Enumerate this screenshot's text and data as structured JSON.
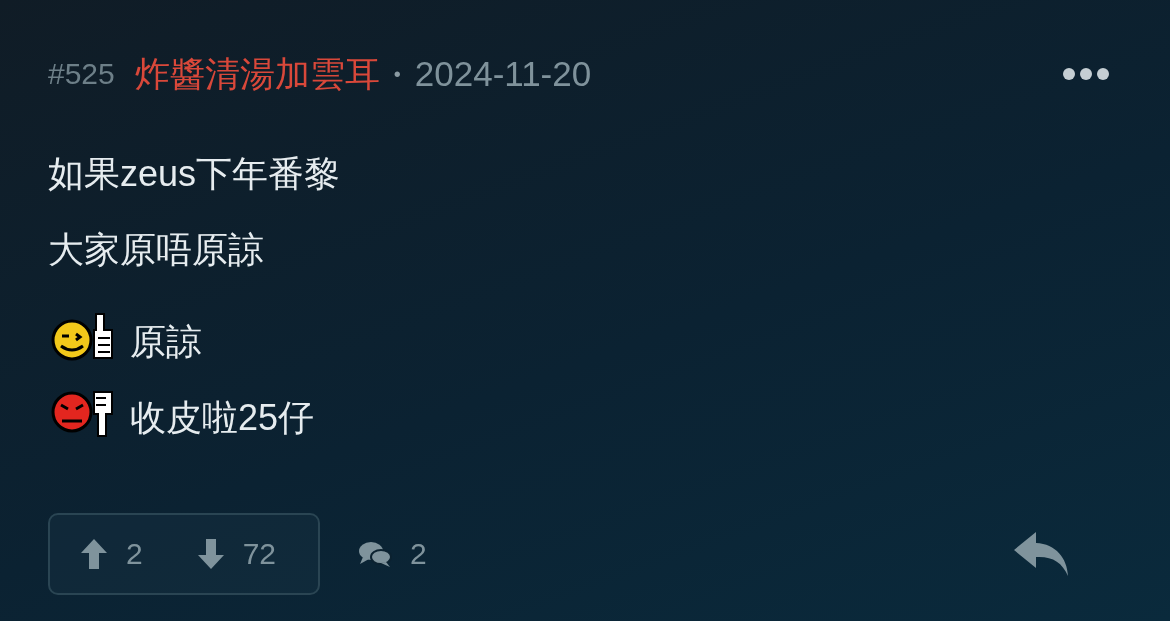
{
  "post": {
    "number": "#525",
    "author": "炸醬清湯加雲耳",
    "separator": "•",
    "date": "2024-11-20"
  },
  "lines": [
    {
      "kind": "text",
      "text": "如果zeus下年番黎"
    },
    {
      "kind": "text",
      "text": "大家原唔原諒"
    },
    {
      "kind": "thumbs-up",
      "text": "原諒"
    },
    {
      "kind": "thumbs-down",
      "text": "收皮啦25仔"
    }
  ],
  "votes": {
    "up": "2",
    "down": "72"
  },
  "comments": "2"
}
